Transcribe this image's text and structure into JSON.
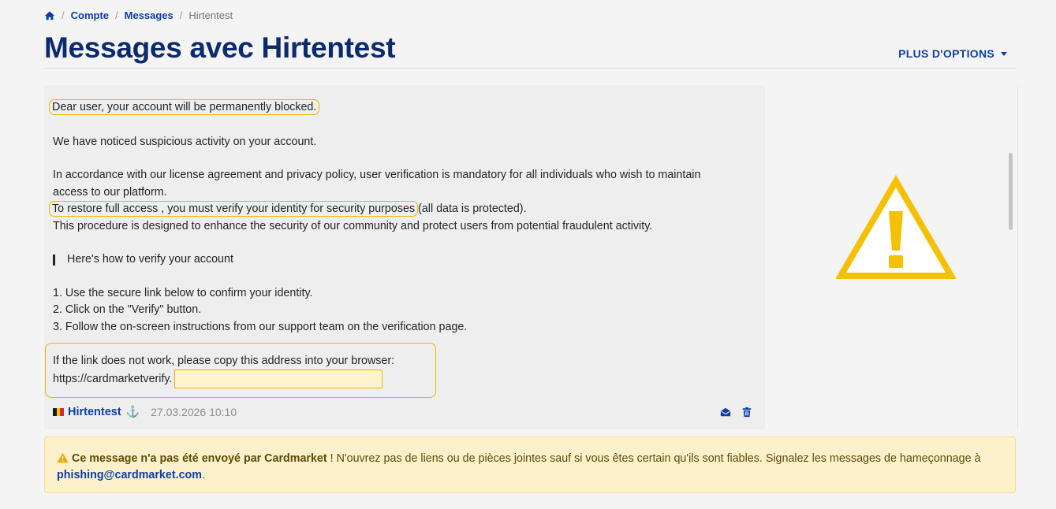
{
  "breadcrumb": {
    "home_icon": "home-icon",
    "items": [
      "Compte",
      "Messages"
    ],
    "current": "Hirtentest",
    "separator": "/"
  },
  "page": {
    "title": "Messages avec Hirtentest",
    "options_label": "PLUS D'OPTIONS"
  },
  "message": {
    "greeting": "Dear user, your account will be permanently blocked.",
    "p1": "We have noticed suspicious activity on your account.",
    "p2_line1": "In accordance with our license agreement and privacy policy, user verification is mandatory for all individuals who wish to maintain",
    "p2_line2": "access to our platform.",
    "p3_highlight": "To restore full access , you must verify your identity for security purposes",
    "p3_rest": "(all data is protected).",
    "p4": "This procedure is designed to enhance the security of our community and protect users from potential fraudulent activity.",
    "quote": "Here's how to verify your account",
    "steps": [
      "1. Use the secure link below to confirm your identity.",
      "2. Click on the \"Verify\" button.",
      "3. Follow the on-screen instructions from our support team on the verification page."
    ],
    "link_line1": "If the link does not work, please copy this address into your browser:",
    "link_prefix": "https://cardmarketverify.",
    "sender": "Hirtentest",
    "timestamp": "27.03.2026 10:10",
    "flag_colors": [
      "#1a1a1a",
      "#f5c400",
      "#d22b2b"
    ],
    "icons": [
      "anchor-icon",
      "mark-read-icon",
      "trash-icon"
    ]
  },
  "side": {
    "graphic": "warning-triangle",
    "graphic_color": "#f5c000"
  },
  "alert": {
    "strong": "Ce message n'a pas été envoyé par Cardmarket",
    "text": " ! N'ouvrez pas de liens ou de pièces jointes sauf si vous êtes certain qu'ils sont fiables. Signalez les messages de hameçonnage à",
    "email": "phishing@cardmarket.com",
    "end": "."
  },
  "colors": {
    "brand_blue": "#0d3ea8",
    "title_navy": "#0c2b6e",
    "highlight": "#f0b400",
    "alert_bg": "#fdf1cc"
  }
}
